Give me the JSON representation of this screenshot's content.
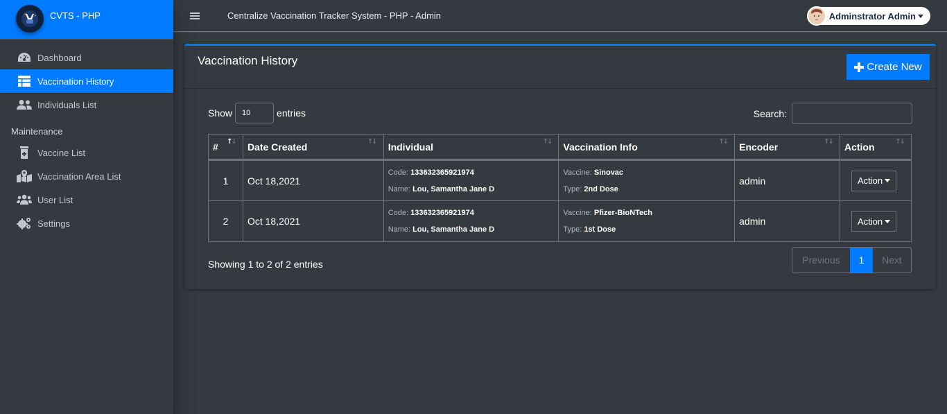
{
  "brand": {
    "name": "CVTS - PHP"
  },
  "sidebar": {
    "items": [
      {
        "label": "Dashboard",
        "icon": "tachometer-icon",
        "active": false
      },
      {
        "label": "Vaccination History",
        "icon": "table-icon",
        "active": true
      },
      {
        "label": "Individuals List",
        "icon": "user-friends-icon",
        "active": false
      }
    ],
    "section_header": "Maintenance",
    "maintenance_items": [
      {
        "label": "Vaccine List",
        "icon": "prescription-bottle-icon"
      },
      {
        "label": "Vaccination Area List",
        "icon": "map-marked-icon"
      },
      {
        "label": "User List",
        "icon": "users-icon"
      },
      {
        "label": "Settings",
        "icon": "cogs-icon"
      }
    ]
  },
  "topbar": {
    "title": "Centralize Vaccination Tracker System - PHP - Admin",
    "user_name": "Adminstrator Admin"
  },
  "card": {
    "title": "Vaccination History",
    "create_label": "Create New"
  },
  "table_controls": {
    "show_label": "Show",
    "entries_label": "entries",
    "page_length": "10",
    "search_label": "Search:",
    "search_value": ""
  },
  "table": {
    "columns": [
      "#",
      "Date Created",
      "Individual",
      "Vaccination Info",
      "Encoder",
      "Action"
    ],
    "code_label": "Code:",
    "name_label": "Name:",
    "vaccine_label": "Vaccine:",
    "type_label": "Type:",
    "action_label": "Action",
    "rows": [
      {
        "num": "1",
        "date": "Oct 18,2021",
        "code": "133632365921974",
        "name": "Lou, Samantha Jane D",
        "vaccine": "Sinovac",
        "type": "2nd Dose",
        "encoder": "admin"
      },
      {
        "num": "2",
        "date": "Oct 18,2021",
        "code": "133632365921974",
        "name": "Lou, Samantha Jane D",
        "vaccine": "Pfizer-BioNTech",
        "type": "1st Dose",
        "encoder": "admin"
      }
    ]
  },
  "footer": {
    "info": "Showing 1 to 2 of 2 entries",
    "previous": "Previous",
    "current_page": "1",
    "next": "Next"
  },
  "colors": {
    "accent": "#007bff",
    "background": "#343a40",
    "border": "#6c757d"
  }
}
